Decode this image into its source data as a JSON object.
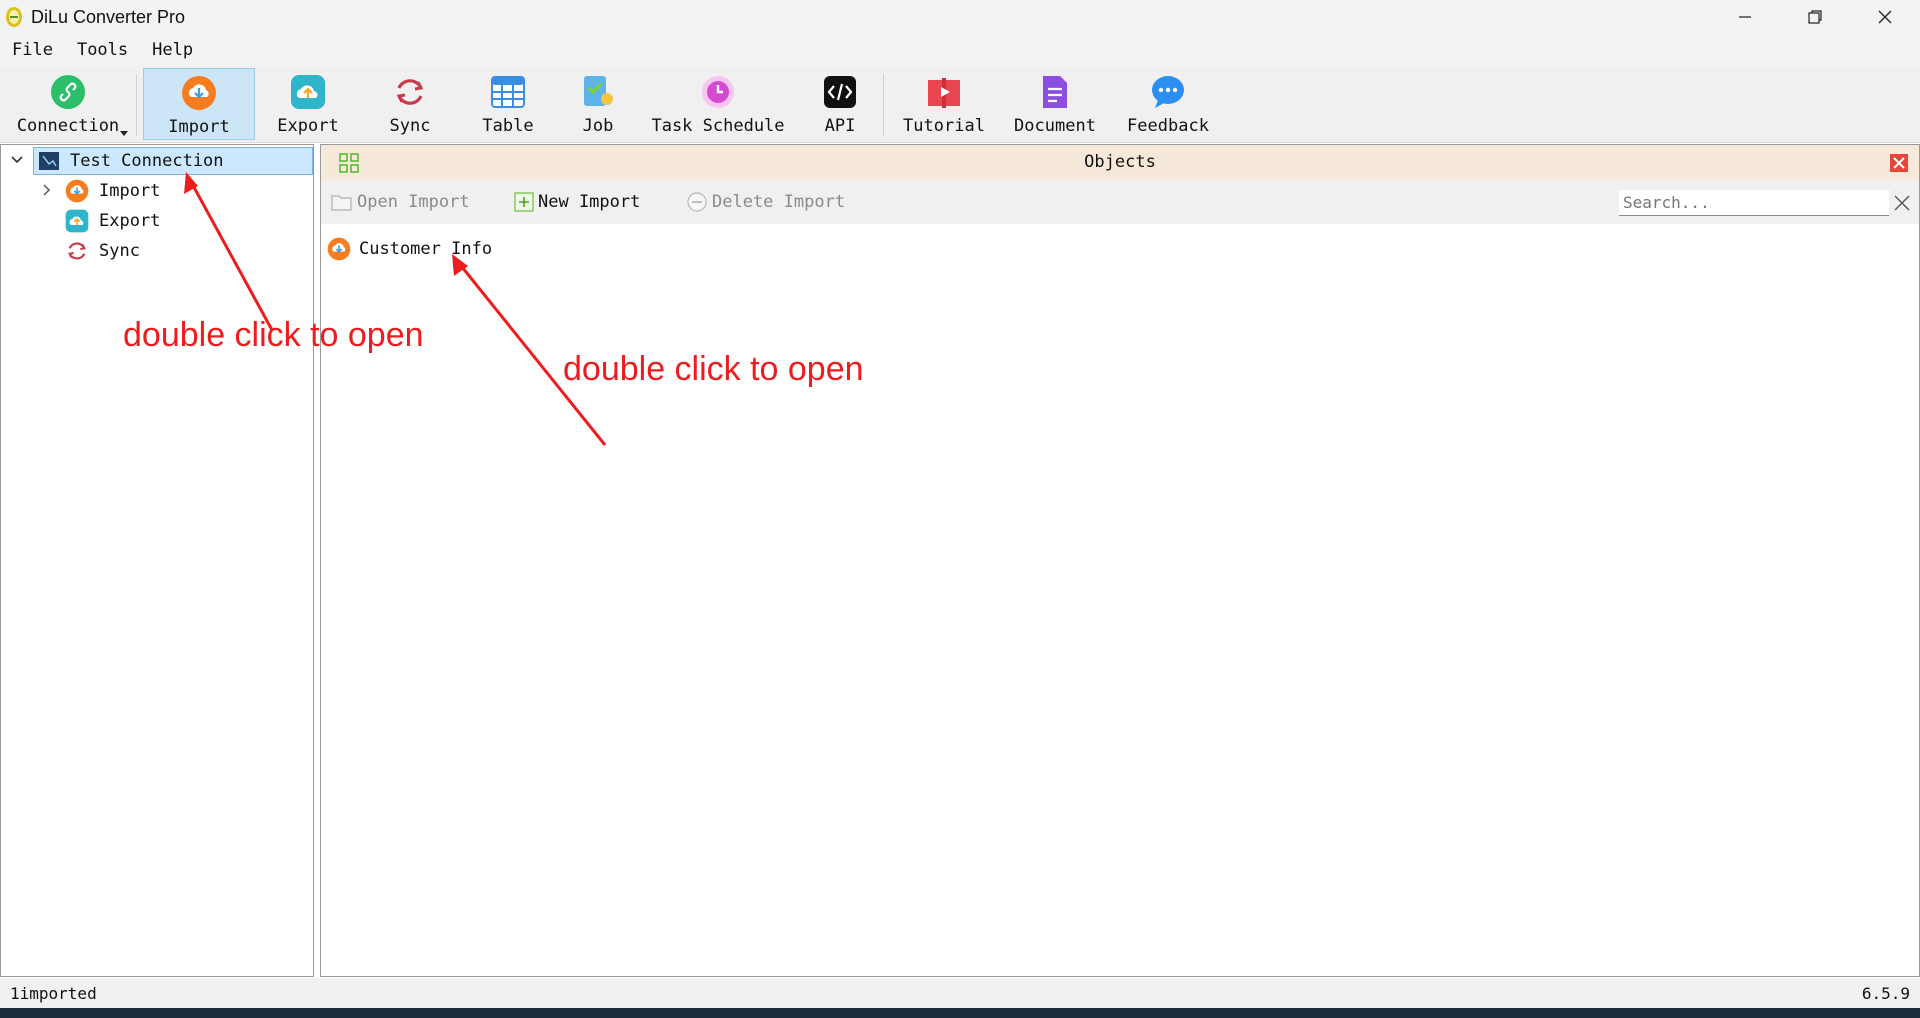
{
  "window": {
    "title": "DiLu Converter Pro"
  },
  "menu": [
    "File",
    "Tools",
    "Help"
  ],
  "toolbar": {
    "connection": "Connection",
    "import": "Import",
    "export": "Export",
    "sync": "Sync",
    "table": "Table",
    "job": "Job",
    "task_schedule": "Task Schedule",
    "api": "API",
    "tutorial": "Tutorial",
    "document": "Document",
    "feedback": "Feedback"
  },
  "tree": {
    "root": "Test Connection",
    "children": [
      "Import",
      "Export",
      "Sync"
    ]
  },
  "objects": {
    "title": "Objects",
    "open_import": "Open Import",
    "new_import": "New Import",
    "delete_import": "Delete Import",
    "search_placeholder": "Search...",
    "items": [
      "Customer Info"
    ]
  },
  "annotations": [
    "double click to open",
    "double click to open"
  ],
  "status": {
    "left": "1imported",
    "version": "6.5.9"
  },
  "colors": {
    "accent_selected": "#cce8ff",
    "objects_header": "#f7e9d9",
    "annotation": "#ee1c1c",
    "import_orange": "#f57c1f"
  }
}
